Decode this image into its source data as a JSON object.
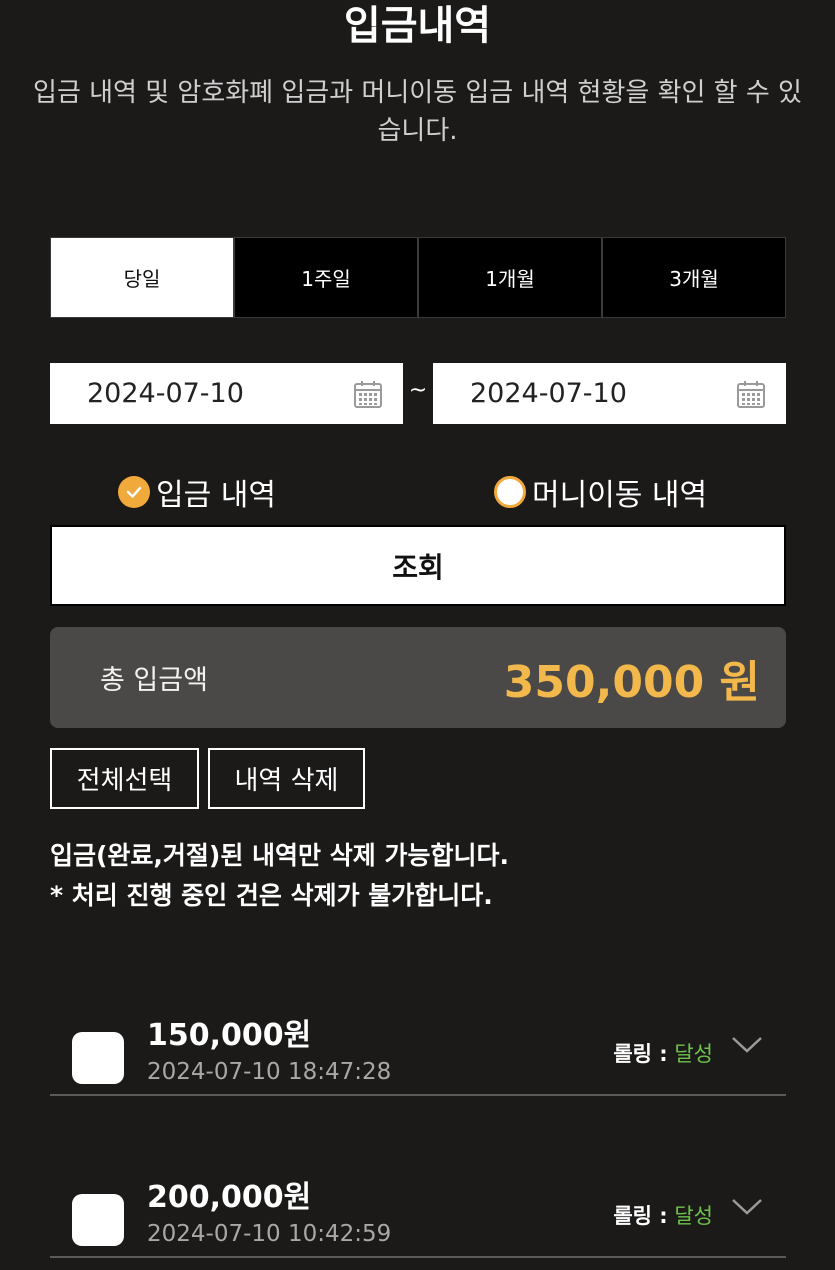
{
  "header": {
    "title": "입금내역",
    "subtitle_line1": "입금 내역 및 암호화폐 입금과 머니이동 입금 내역 현황을 확인 할 수 있",
    "subtitle_line2": "습니다."
  },
  "period_tabs": [
    {
      "label": "당일",
      "active": true
    },
    {
      "label": "1주일",
      "active": false
    },
    {
      "label": "1개월",
      "active": false
    },
    {
      "label": "3개월",
      "active": false
    }
  ],
  "date_range": {
    "start": "2024-07-10",
    "separator": "~",
    "end": "2024-07-10",
    "icon": "calendar-icon"
  },
  "history_type": {
    "options": [
      {
        "label": "입금 내역",
        "checked": true
      },
      {
        "label": "머니이동 내역",
        "checked": false
      }
    ]
  },
  "search_button": "조회",
  "total": {
    "label": "총 입금액",
    "amount": "350,000 원"
  },
  "actions": {
    "select_all": "전체선택",
    "delete": "내역 삭제"
  },
  "notices": [
    "입금(완료,거절)된 내역만 삭제 가능합니다.",
    "* 처리 진행 중인 건은 삭제가 불가합니다."
  ],
  "deposits": [
    {
      "amount": "150,000원",
      "time": "2024-07-10 18:47:28",
      "status_key": "롤링 :",
      "status_value": "달성"
    },
    {
      "amount": "200,000원",
      "time": "2024-07-10 10:42:59",
      "status_key": "롤링 :",
      "status_value": "달성"
    }
  ],
  "colors": {
    "background": "#1b1a19",
    "accent": "#f2a93b",
    "amount": "#f2b84b",
    "status_ok": "#6cc24a",
    "panel": "#4a4948"
  }
}
